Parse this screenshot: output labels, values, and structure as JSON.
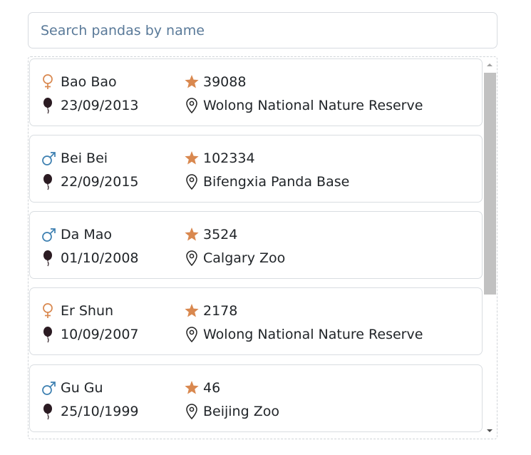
{
  "search": {
    "placeholder": "Search pandas by name",
    "value": ""
  },
  "colors": {
    "female": "#d9884f",
    "male": "#3c7fb0",
    "star": "#d9884f",
    "balloon": "#2b1b22",
    "pin": "#222222",
    "scrollbar_thumb": "#c1c1c1"
  },
  "pandas": [
    {
      "gender": "female",
      "gender_icon": "female-icon",
      "name": "Bao Bao",
      "stars": "39088",
      "birthdate": "23/09/2013",
      "location": "Wolong National Nature Reserve"
    },
    {
      "gender": "male",
      "gender_icon": "male-icon",
      "name": "Bei Bei",
      "stars": "102334",
      "birthdate": "22/09/2015",
      "location": "Bifengxia Panda Base"
    },
    {
      "gender": "male",
      "gender_icon": "male-icon",
      "name": "Da Mao",
      "stars": "3524",
      "birthdate": "01/10/2008",
      "location": "Calgary Zoo"
    },
    {
      "gender": "female",
      "gender_icon": "female-icon",
      "name": "Er Shun",
      "stars": "2178",
      "birthdate": "10/09/2007",
      "location": "Wolong National Nature Reserve"
    },
    {
      "gender": "male",
      "gender_icon": "male-icon",
      "name": "Gu Gu",
      "stars": "46",
      "birthdate": "25/10/1999",
      "location": "Beijing Zoo"
    }
  ],
  "scroll": {
    "position_fraction": 0.0,
    "visible_fraction": 0.6
  }
}
